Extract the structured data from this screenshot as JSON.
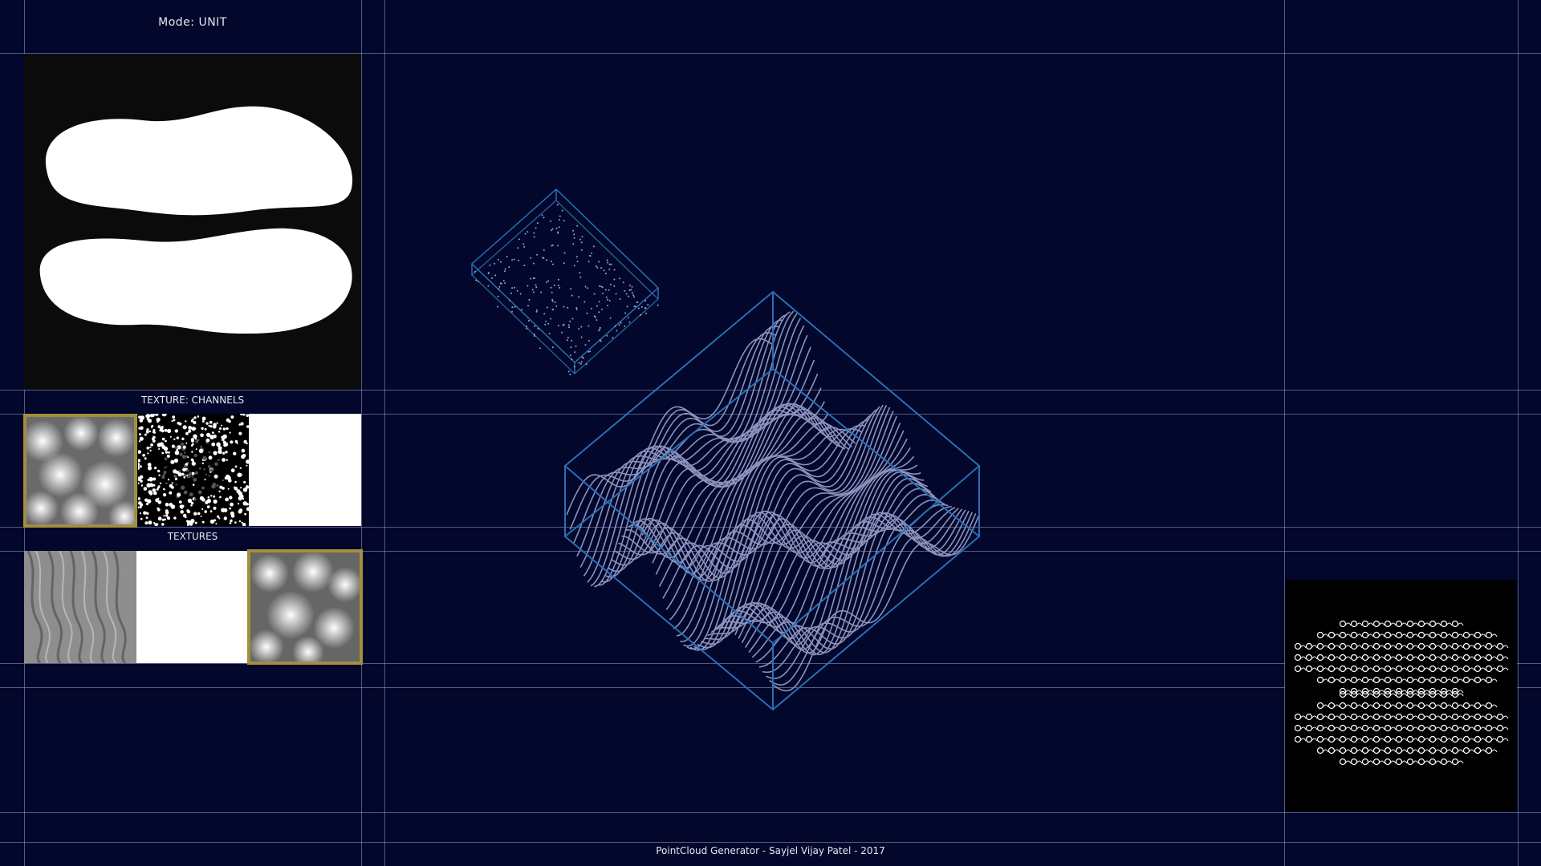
{
  "app": {
    "mode_label": "Mode: UNIT",
    "credits": "PointCloud Generator - Sayjel Vijay Patel - 2017"
  },
  "left_panel": {
    "channels_label": "TEXTURE: CHANNELS",
    "textures_label": "TEXTURES",
    "channel_tiles": [
      {
        "name": "blob-noise",
        "selected": true
      },
      {
        "name": "voronoi-noise",
        "selected": false
      },
      {
        "name": "white-blank",
        "selected": false
      }
    ],
    "texture_tiles": [
      {
        "name": "ridge-noise",
        "selected": false
      },
      {
        "name": "white-blank",
        "selected": false
      },
      {
        "name": "blob-noise",
        "selected": true
      }
    ]
  },
  "colors": {
    "background": "#02072b",
    "wireframe": "#2a6fb5",
    "points": "#9aa3cf",
    "selection": "#a1903c"
  }
}
